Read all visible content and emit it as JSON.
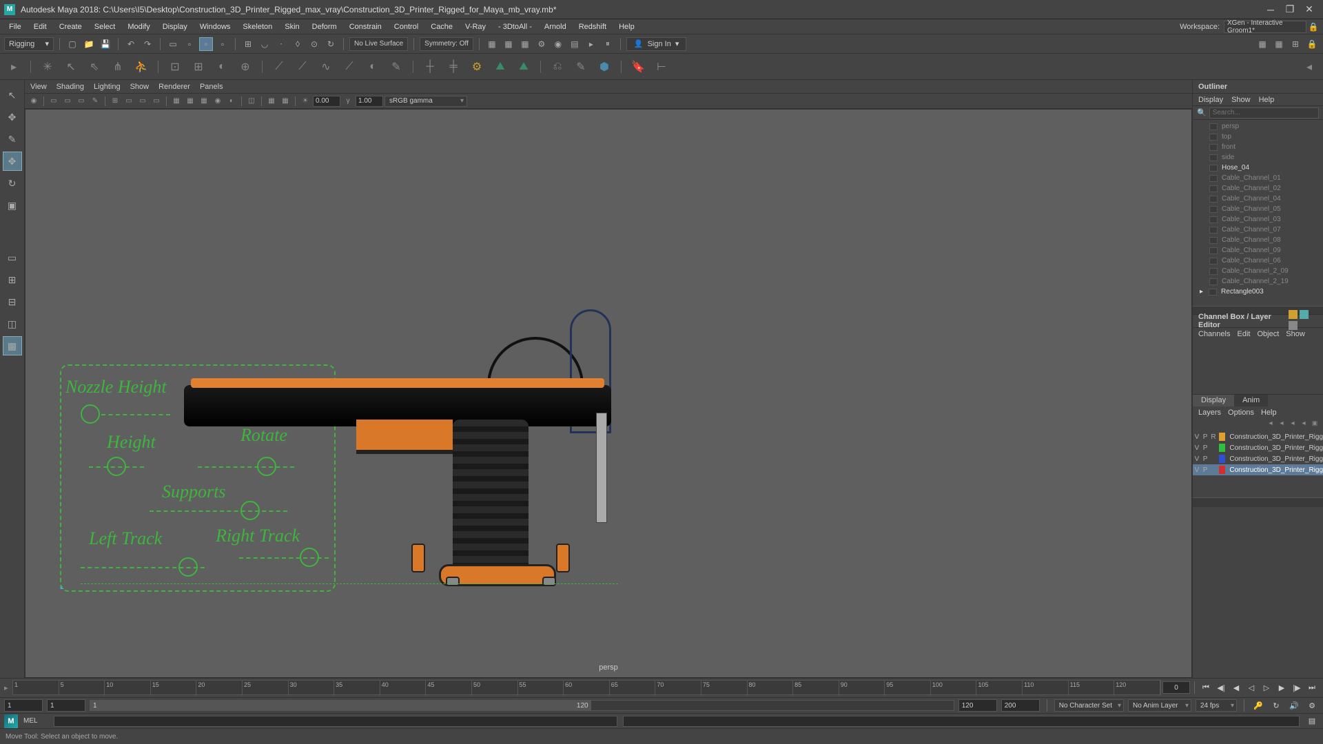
{
  "title": "Autodesk Maya 2018: C:\\Users\\I5\\Desktop\\Construction_3D_Printer_Rigged_max_vray\\Construction_3D_Printer_Rigged_for_Maya_mb_vray.mb*",
  "app_icon": "M",
  "menubar": [
    "File",
    "Edit",
    "Create",
    "Select",
    "Modify",
    "Display",
    "Windows",
    "Skeleton",
    "Skin",
    "Deform",
    "Constrain",
    "Control",
    "Cache",
    "V-Ray",
    "- 3DtoAll -",
    "Arnold",
    "Redshift",
    "Help"
  ],
  "workspace": {
    "label": "Workspace: ",
    "value": "XGen - Interactive Groom1*"
  },
  "shelf": {
    "mode": "Rigging",
    "live_surface": "No Live Surface",
    "symmetry": "Symmetry: Off",
    "signin": "Sign In"
  },
  "panel_menu": [
    "View",
    "Shading",
    "Lighting",
    "Show",
    "Renderer",
    "Panels"
  ],
  "panel_tb": {
    "near": "0.00",
    "far": "1.00",
    "gamma": "sRGB gamma"
  },
  "viewport": {
    "camera": "persp",
    "rig_labels": {
      "nozzle": "Nozzle Height",
      "height": "Height",
      "rotate": "Rotate",
      "supports": "Supports",
      "left_track": "Left Track",
      "right_track": "Right Track"
    }
  },
  "outliner": {
    "title": "Outliner",
    "menu": [
      "Display",
      "Show",
      "Help"
    ],
    "search_ph": "Search...",
    "items": [
      {
        "name": "persp",
        "t": "cam"
      },
      {
        "name": "top",
        "t": "cam"
      },
      {
        "name": "front",
        "t": "cam"
      },
      {
        "name": "side",
        "t": "cam"
      },
      {
        "name": "Hose_04",
        "t": "geo",
        "act": true
      },
      {
        "name": "Cable_Channel_01",
        "t": "geo"
      },
      {
        "name": "Cable_Channel_02",
        "t": "geo"
      },
      {
        "name": "Cable_Channel_04",
        "t": "geo"
      },
      {
        "name": "Cable_Channel_05",
        "t": "geo"
      },
      {
        "name": "Cable_Channel_03",
        "t": "geo"
      },
      {
        "name": "Cable_Channel_07",
        "t": "geo"
      },
      {
        "name": "Cable_Channel_08",
        "t": "geo"
      },
      {
        "name": "Cable_Channel_09",
        "t": "geo"
      },
      {
        "name": "Cable_Channel_06",
        "t": "geo"
      },
      {
        "name": "Cable_Channel_2_09",
        "t": "geo"
      },
      {
        "name": "Cable_Channel_2_19",
        "t": "geo"
      },
      {
        "name": "Rectangle003",
        "t": "geo",
        "act": true,
        "exp": true
      }
    ]
  },
  "channelbox": {
    "title": "Channel Box / Layer Editor",
    "menu": [
      "Channels",
      "Edit",
      "Object",
      "Show"
    ]
  },
  "displaylayers": {
    "tabs": {
      "display": "Display",
      "anim": "Anim"
    },
    "menu": [
      "Layers",
      "Options",
      "Help"
    ],
    "cols": {
      "v": "V",
      "p": "P",
      "r": "R"
    },
    "rows": [
      {
        "v": "V",
        "p": "P",
        "r": "R",
        "c": "#e0a030",
        "name": "Construction_3D_Printer_Rigg"
      },
      {
        "v": "V",
        "p": "P",
        "r": "",
        "c": "#30c040",
        "name": "Construction_3D_Printer_Rigg"
      },
      {
        "v": "V",
        "p": "P",
        "r": "",
        "c": "#3050d0",
        "name": "Construction_3D_Printer_Rigg"
      },
      {
        "v": "V",
        "p": "P",
        "r": "",
        "c": "#d03030",
        "name": "Construction_3D_Printer_Rigg",
        "sel": true
      }
    ]
  },
  "timeline": {
    "ticks": [
      "1",
      "5",
      "10",
      "15",
      "20",
      "25",
      "30",
      "35",
      "40",
      "45",
      "50",
      "55",
      "60",
      "65",
      "70",
      "75",
      "80",
      "85",
      "90",
      "95",
      "100",
      "105",
      "110",
      "115",
      "120"
    ],
    "current": "0"
  },
  "range": {
    "start_out": "1",
    "start_in": "1",
    "end_in": "120",
    "end_out": "200",
    "slider_start": "1",
    "slider_end": "120",
    "charset": "No Character Set",
    "animlayer": "No Anim Layer",
    "fps": "24 fps"
  },
  "cmd": {
    "lang": "MEL"
  },
  "status": {
    "text": "Move Tool: Select an object to move."
  }
}
